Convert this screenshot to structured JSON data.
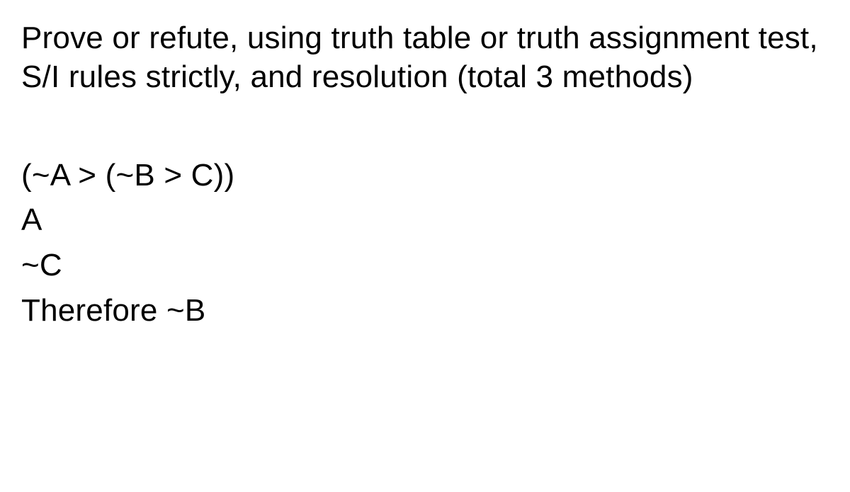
{
  "instruction": "Prove or refute, using truth table or truth assignment test, S/I rules strictly, and resolution (total 3 methods)",
  "argument": {
    "premise1": "(~A > (~B > C))",
    "premise2": "A",
    "premise3": "~C",
    "conclusion": "Therefore ~B"
  }
}
